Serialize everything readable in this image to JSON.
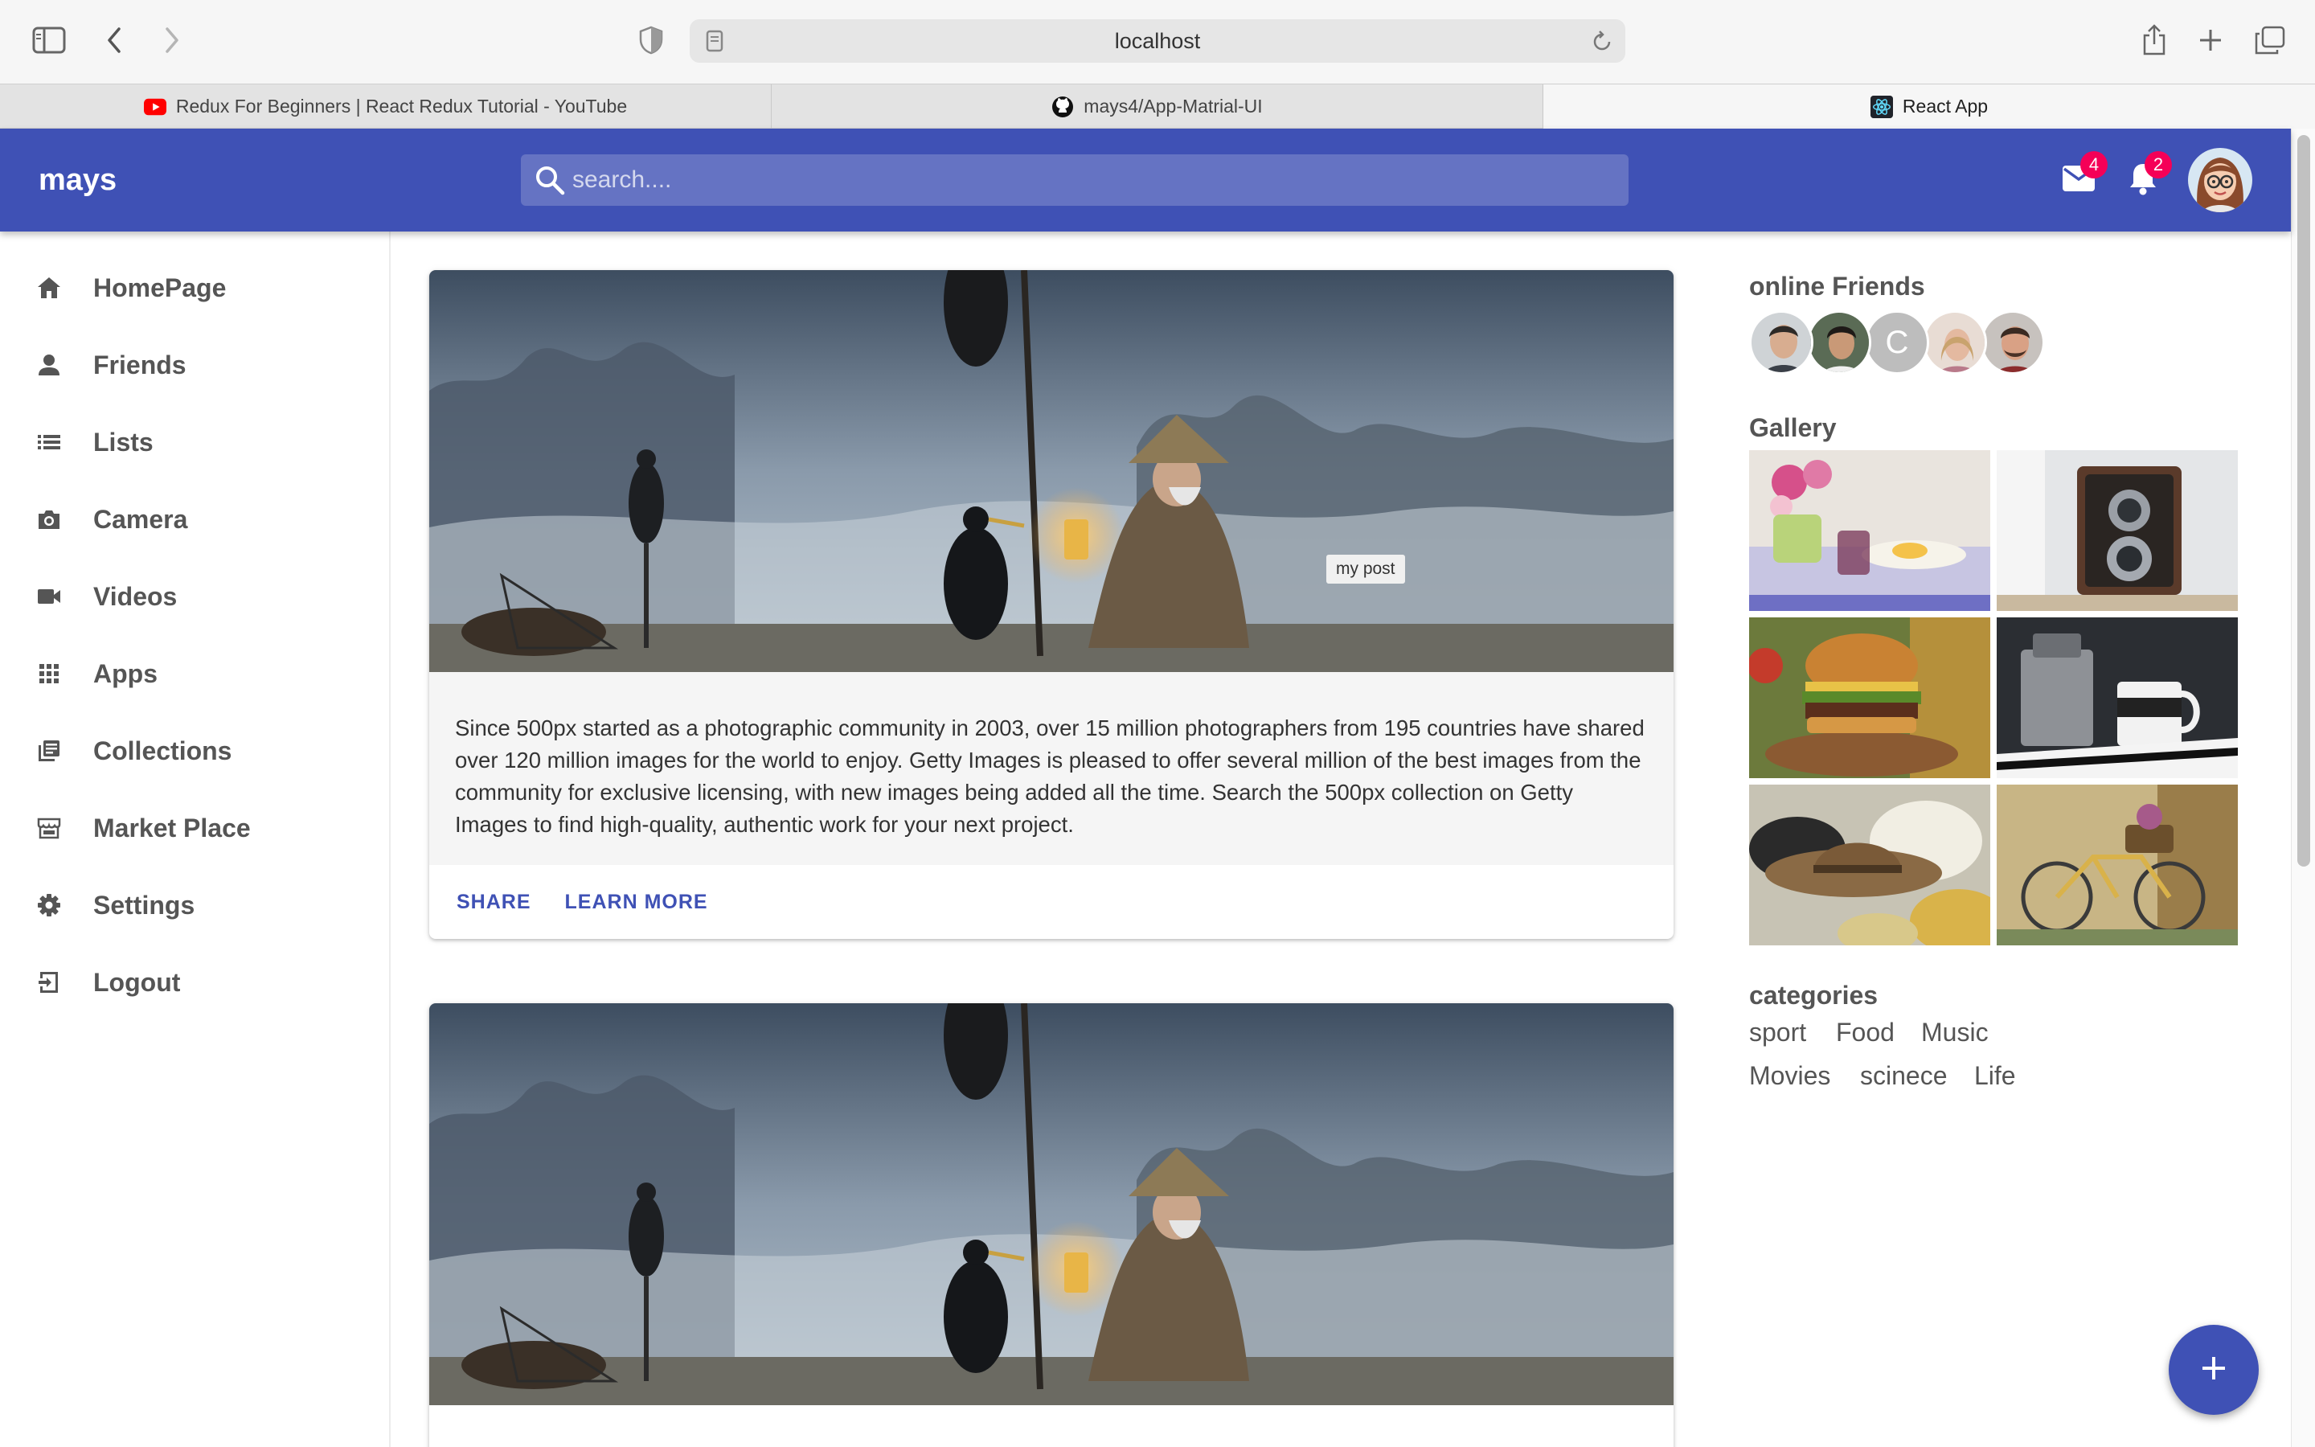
{
  "browser": {
    "url": "localhost",
    "tabs": [
      {
        "title": "Redux For Beginners | React Redux Tutorial - YouTube",
        "favicon": "youtube-icon"
      },
      {
        "title": "mays4/App-Matrial-UI",
        "favicon": "github-icon"
      },
      {
        "title": "React App",
        "favicon": "react-icon",
        "active": true
      }
    ]
  },
  "header": {
    "brand": "mays",
    "search_placeholder": "search....",
    "mail_count": "4",
    "notification_count": "2",
    "color": "#3f51b5"
  },
  "sidebar": {
    "items": [
      {
        "label": "HomePage",
        "icon": "home-icon"
      },
      {
        "label": "Friends",
        "icon": "person-icon"
      },
      {
        "label": "Lists",
        "icon": "list-icon"
      },
      {
        "label": "Camera",
        "icon": "camera-icon"
      },
      {
        "label": "Videos",
        "icon": "videocam-icon"
      },
      {
        "label": "Apps",
        "icon": "apps-icon"
      },
      {
        "label": "Collections",
        "icon": "collections-icon"
      },
      {
        "label": "Market Place",
        "icon": "storefront-icon"
      },
      {
        "label": "Settings",
        "icon": "settings-icon"
      },
      {
        "label": "Logout",
        "icon": "logout-icon"
      }
    ]
  },
  "feed": {
    "posts": [
      {
        "tooltip": "my post",
        "text": "Since 500px started as a photographic community in 2003, over 15 million photographers from 195 countries have shared over 120 million images for the world to enjoy. Getty Images is pleased to offer several million of the best images from the community for exclusive licensing, with new images being added all the time. Search the 500px collection on Getty Images to find high-quality, authentic work for your next project.",
        "share_label": "SHARE",
        "learn_more_label": "LEARN MORE"
      }
    ]
  },
  "rightbar": {
    "online_title": "online Friends",
    "friend_initial": "C",
    "gallery_title": "Gallery",
    "gallery": [
      "flowers-breakfast",
      "vintage-camera",
      "burger",
      "coffee-mug",
      "hats",
      "bicycle"
    ],
    "categories_title": "categories",
    "categories": [
      "sport",
      "Food",
      "Music",
      "Movies",
      "scinece",
      "Life"
    ]
  }
}
